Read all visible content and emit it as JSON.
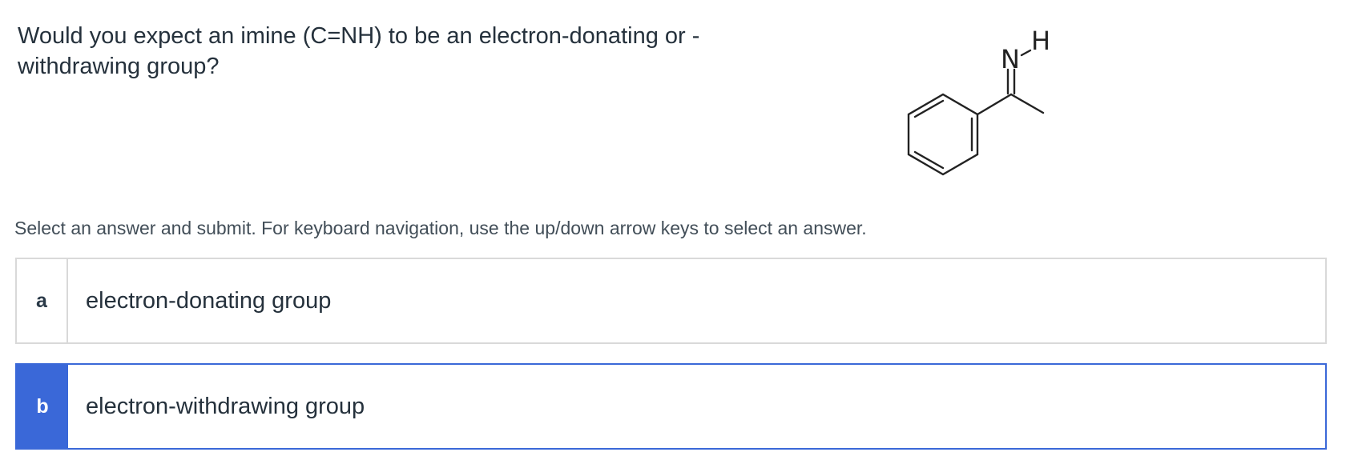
{
  "question": {
    "text": "Would you expect an imine (C=NH) to be an electron-donating or -withdrawing group?"
  },
  "molecule": {
    "atom_n": "N",
    "atom_h": "H"
  },
  "instructions": "Select an answer and submit. For keyboard navigation, use the up/down arrow keys to select an answer.",
  "options": [
    {
      "letter": "a",
      "label": "electron-donating group",
      "selected": false
    },
    {
      "letter": "b",
      "label": "electron-withdrawing group",
      "selected": true
    }
  ],
  "colors": {
    "selected_accent": "#3a68d8",
    "border": "#d9d9d9",
    "text": "#25313c"
  },
  "icons": {
    "molecule": "imine-structure-diagram"
  }
}
